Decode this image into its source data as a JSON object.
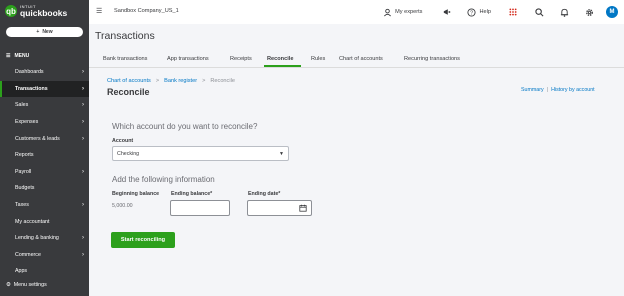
{
  "brand": {
    "intuit": "INTUIT",
    "name": "quickbooks"
  },
  "sidebar": {
    "new_label": "New",
    "menu_label": "MENU",
    "items": [
      {
        "label": "Dashboards",
        "chevron": true,
        "active": false
      },
      {
        "label": "Transactions",
        "chevron": true,
        "active": true
      },
      {
        "label": "Sales",
        "chevron": true,
        "active": false
      },
      {
        "label": "Expenses",
        "chevron": true,
        "active": false
      },
      {
        "label": "Customers & leads",
        "chevron": true,
        "active": false
      },
      {
        "label": "Reports",
        "chevron": false,
        "active": false
      },
      {
        "label": "Payroll",
        "chevron": true,
        "active": false
      },
      {
        "label": "Budgets",
        "chevron": false,
        "active": false
      },
      {
        "label": "Taxes",
        "chevron": true,
        "active": false
      },
      {
        "label": "My accountant",
        "chevron": false,
        "active": false
      },
      {
        "label": "Lending & banking",
        "chevron": true,
        "active": false
      },
      {
        "label": "Commerce",
        "chevron": true,
        "active": false
      },
      {
        "label": "Apps",
        "chevron": false,
        "active": false
      }
    ],
    "settings_label": "Menu settings"
  },
  "topbar": {
    "company": "Sandbox Company_US_1",
    "experts": "My experts",
    "help": "Help",
    "avatar_initial": "M"
  },
  "page": {
    "title": "Transactions",
    "tabs": [
      "Bank transactions",
      "App transactions",
      "Receipts",
      "Reconcile",
      "Rules",
      "Chart of accounts",
      "Recurring transactions"
    ],
    "active_tab": "Reconcile"
  },
  "breadcrumb": {
    "link1": "Chart of accounts",
    "link2": "Bank register",
    "current": "Reconcile",
    "sep": ">"
  },
  "reconcile": {
    "title": "Reconcile",
    "summary": "Summary",
    "history": "History by account",
    "question": "Which account do you want to reconcile?",
    "account_label": "Account",
    "account_value": "Checking",
    "info_heading": "Add the following information",
    "beginning_label": "Beginning balance",
    "beginning_value": "5,000.00",
    "ending_balance_label": "Ending balance*",
    "ending_date_label": "Ending date*",
    "start_button": "Start reconciling"
  },
  "colors": {
    "brand_green": "#2ca01c",
    "link_blue": "#0077c5",
    "sidebar_bg": "#393a3d"
  }
}
